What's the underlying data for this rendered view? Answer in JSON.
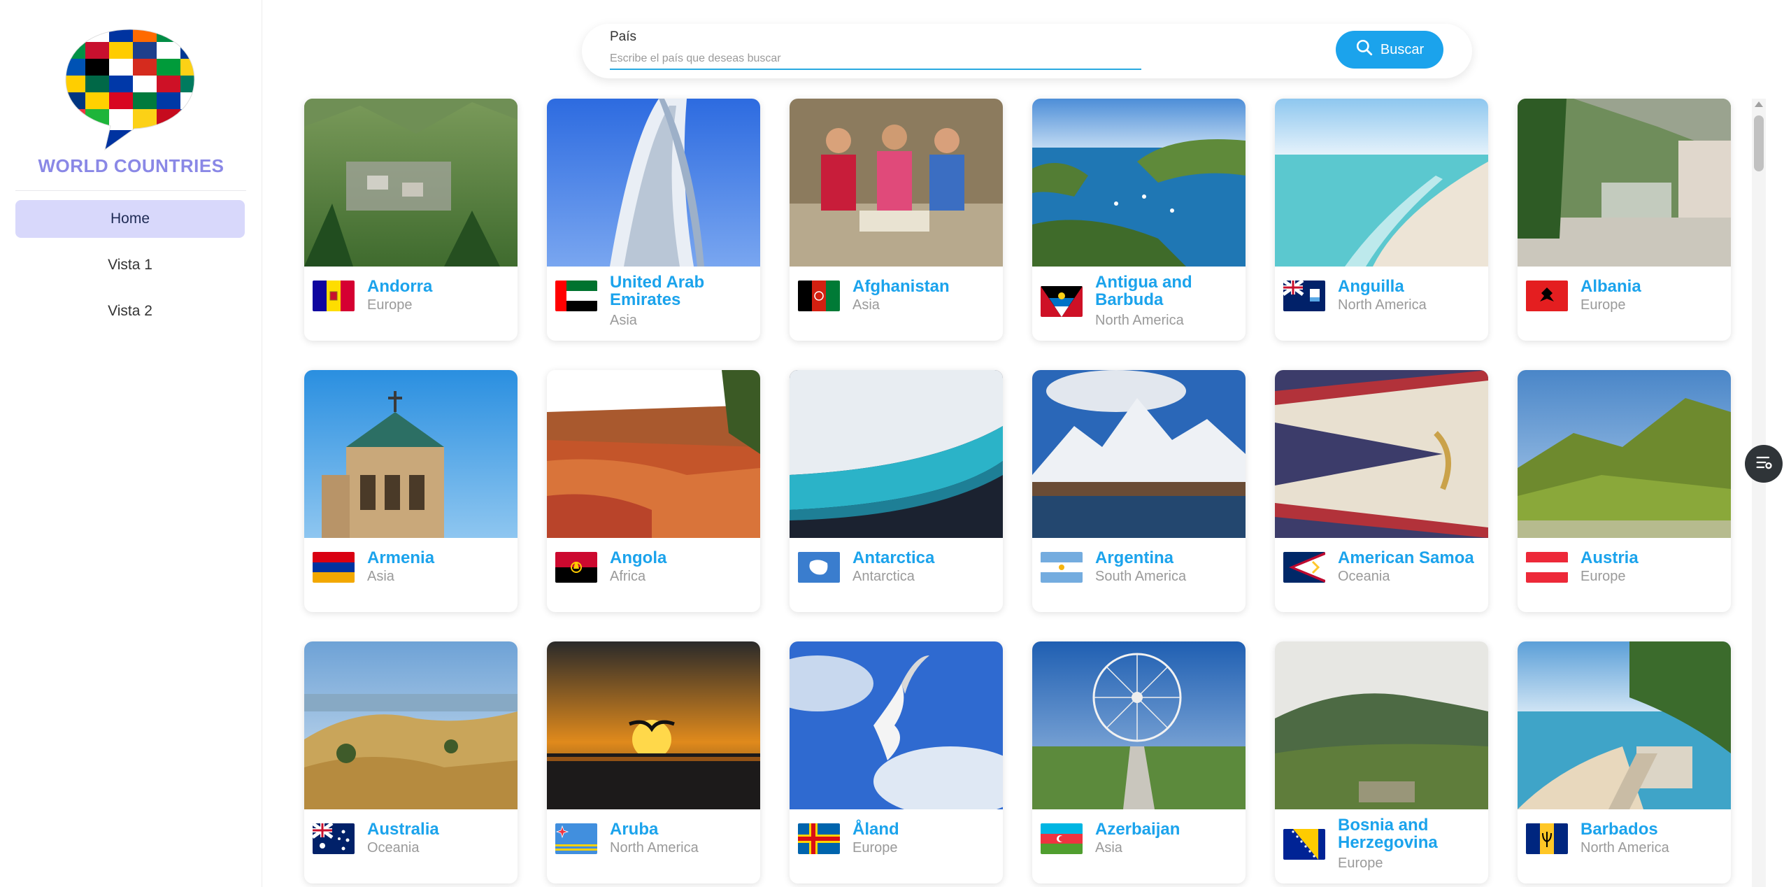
{
  "app": {
    "title": "WORLD COUNTRIES"
  },
  "nav": {
    "items": [
      {
        "label": "Home",
        "active": true
      },
      {
        "label": "Vista 1",
        "active": false
      },
      {
        "label": "Vista 2",
        "active": false
      }
    ]
  },
  "search": {
    "label": "País",
    "placeholder": "Escribe el país que deseas buscar",
    "value": "",
    "button_label": "Buscar",
    "button_icon": "search-icon"
  },
  "colors": {
    "accent": "#1ba3ec",
    "brand": "#8a88e6",
    "nav_active_bg": "#d8d8fb"
  },
  "countries": [
    {
      "name": "Andorra",
      "region": "Europe"
    },
    {
      "name": "United Arab Emirates",
      "region": "Asia"
    },
    {
      "name": "Afghanistan",
      "region": "Asia"
    },
    {
      "name": "Antigua and Barbuda",
      "region": "North America"
    },
    {
      "name": "Anguilla",
      "region": "North America"
    },
    {
      "name": "Albania",
      "region": "Europe"
    },
    {
      "name": "Armenia",
      "region": "Asia"
    },
    {
      "name": "Angola",
      "region": "Africa"
    },
    {
      "name": "Antarctica",
      "region": "Antarctica"
    },
    {
      "name": "Argentina",
      "region": "South America"
    },
    {
      "name": "American Samoa",
      "region": "Oceania"
    },
    {
      "name": "Austria",
      "region": "Europe"
    },
    {
      "name": "Australia",
      "region": "Oceania"
    },
    {
      "name": "Aruba",
      "region": "North America"
    },
    {
      "name": "Åland",
      "region": "Europe"
    },
    {
      "name": "Azerbaijan",
      "region": "Asia"
    },
    {
      "name": "Bosnia and Herzegovina",
      "region": "Europe"
    },
    {
      "name": "Barbados",
      "region": "North America"
    }
  ],
  "floating_button": {
    "icon": "filter-list-icon"
  }
}
